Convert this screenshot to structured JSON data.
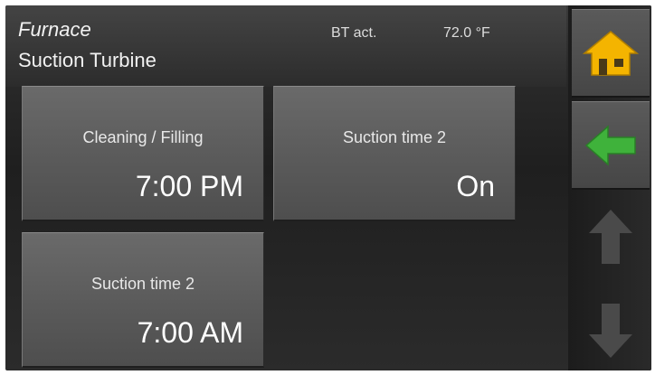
{
  "header": {
    "title": "Furnace",
    "subtitle": "Suction Turbine",
    "bt_label": "BT act.",
    "bt_value": "72.0 °F"
  },
  "tiles": [
    {
      "label": "Cleaning / Filling",
      "value": "7:00 PM"
    },
    {
      "label": "Suction time 2",
      "value": "On"
    },
    {
      "label": "Suction time 2",
      "value": "7:00 AM"
    }
  ],
  "sidebar": {
    "buttons": [
      {
        "icon": "home-icon",
        "state": "active",
        "color": "#f4b400"
      },
      {
        "icon": "back-arrow-icon",
        "state": "active",
        "color": "#3fb23b"
      },
      {
        "icon": "arrow-up-icon",
        "state": "disabled",
        "color": "#4a4a4a"
      },
      {
        "icon": "arrow-down-icon",
        "state": "disabled",
        "color": "#4a4a4a"
      }
    ]
  }
}
